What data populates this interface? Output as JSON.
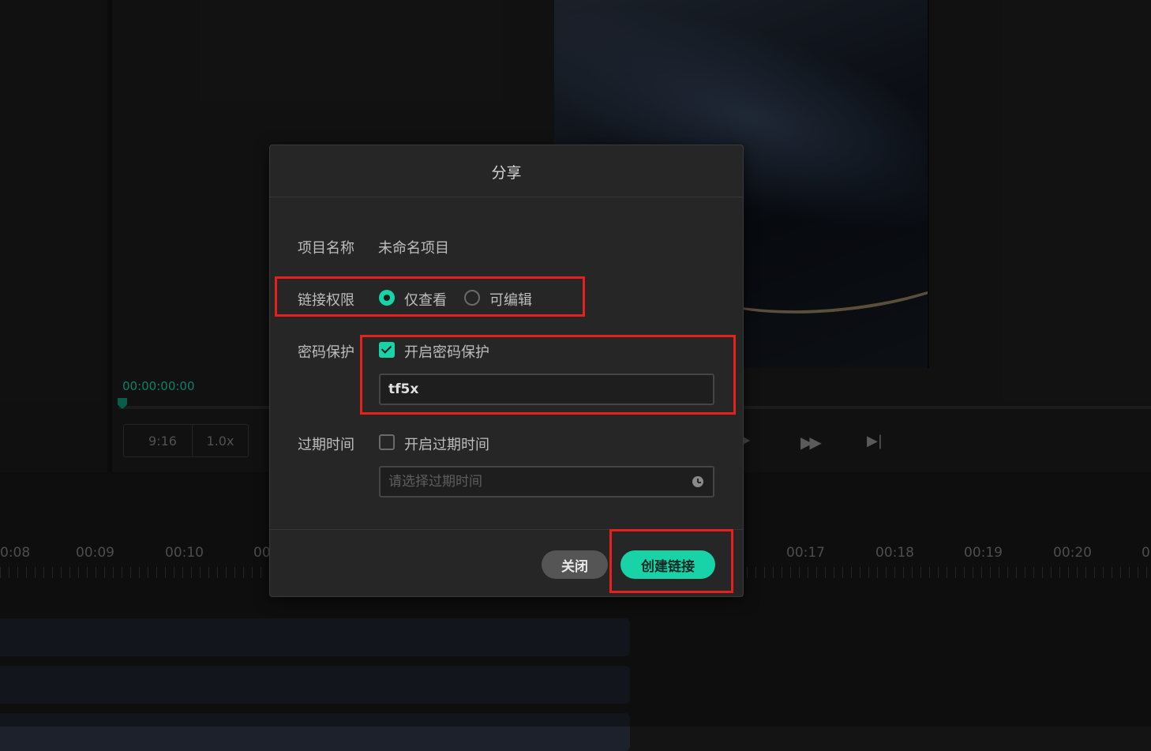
{
  "player": {
    "timecode": "00:00:00:00",
    "ratio_label": "9:16",
    "speed_label": "1.0x"
  },
  "timeline": {
    "labels_left": [
      "0:08",
      "00:09",
      "00:10",
      "00"
    ],
    "labels_right": [
      "00:17",
      "00:18",
      "00:19",
      "00:20",
      "0"
    ]
  },
  "dialog": {
    "title": "分享",
    "project_name_label": "项目名称",
    "project_name_value": "未命名项目",
    "permission_label": "链接权限",
    "permission_options": [
      {
        "label": "仅查看",
        "selected": true
      },
      {
        "label": "可编辑",
        "selected": false
      }
    ],
    "password_label": "密码保护",
    "password_toggle_label": "开启密码保护",
    "password_enabled": true,
    "password_value": "tf5x",
    "expiry_label": "过期时间",
    "expiry_toggle_label": "开启过期时间",
    "expiry_enabled": false,
    "expiry_placeholder": "请选择过期时间",
    "close_button": "关闭",
    "create_button": "创建链接"
  },
  "colors": {
    "accent": "#19d3a8",
    "highlight": "#e8201c",
    "dialog_bg": "#262626"
  }
}
